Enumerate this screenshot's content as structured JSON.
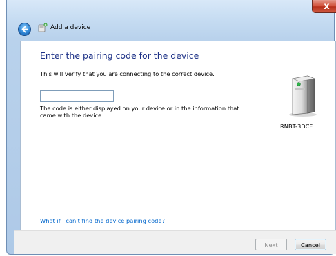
{
  "window": {
    "title": "Add a device",
    "close_label": "x"
  },
  "main": {
    "heading": "Enter the pairing code for the device",
    "subtext": "This will verify that you are connecting to the correct device.",
    "input_value": "",
    "hint": "The code is either displayed on your device or in the information that came with the device.",
    "device_name": "RNBT-3DCF",
    "help_link": "What if I can't find the device pairing code?"
  },
  "footer": {
    "next_label": "Next",
    "cancel_label": "Cancel"
  },
  "icons": {
    "back": "back-arrow-icon",
    "device_header": "device-icon",
    "device": "desktop-tower-icon"
  }
}
